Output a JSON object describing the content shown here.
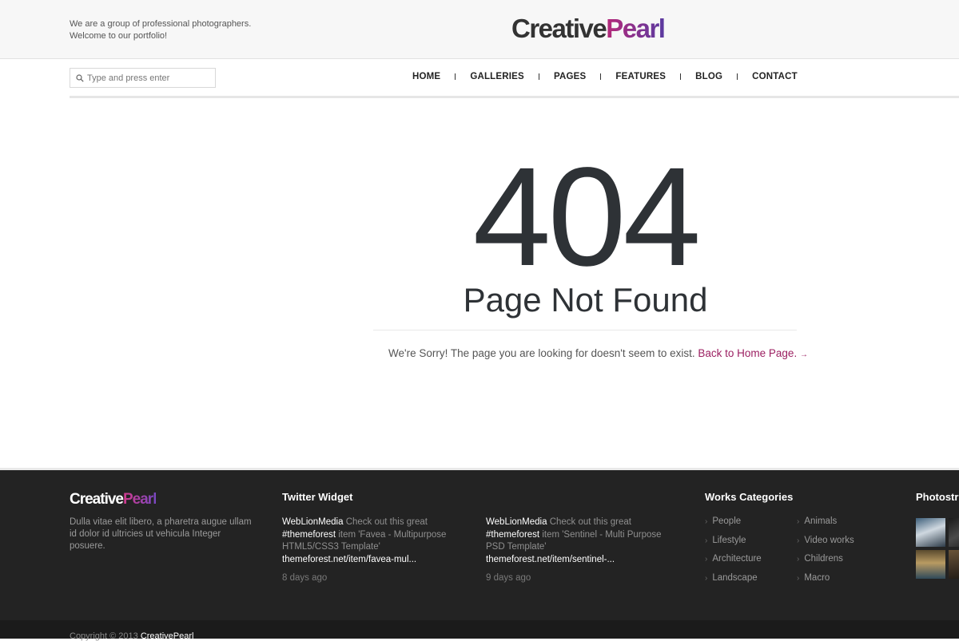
{
  "header": {
    "tagline_line1": "We are a group of professional photographers.",
    "tagline_line2": "Welcome to our portfolio!",
    "logo_part1": "Creative",
    "logo_part2": "Pearl"
  },
  "search": {
    "placeholder": "Type and press enter"
  },
  "nav": {
    "items": [
      "HOME",
      "GALLERIES",
      "PAGES",
      "FEATURES",
      "BLOG",
      "CONTACT"
    ]
  },
  "error": {
    "code": "404",
    "title": "Page Not Found",
    "message": "We're Sorry! The page you are looking for doesn't seem to exist.",
    "link_text": "Back to Home Page.",
    "link_arrow": "→"
  },
  "footer": {
    "logo_part1": "Creative",
    "logo_part2": "Pearl",
    "about": "Dulla vitae elit libero, a pharetra augue ullam id dolor id ultricies ut vehicula Integer posuere.",
    "twitter_title": "Twitter Widget",
    "tweets": [
      {
        "user": "WebLionMedia",
        "text_before": " Check out this great ",
        "hashtag": "#themeforest",
        "text_after": " item 'Favea - Multipurpose HTML5/CSS3 Template' ",
        "link": "themeforest.net/item/favea-mul...",
        "time": "8 days ago"
      },
      {
        "user": "WebLionMedia",
        "text_before": " Check out this great ",
        "hashtag": "#themeforest",
        "text_after": " item 'Sentinel - Multi Purpose PSD Template' ",
        "link": "themeforest.net/item/sentinel-...",
        "time": "9 days ago"
      }
    ],
    "categories_title": "Works Categories",
    "categories_col1": [
      "People",
      "Lifestyle",
      "Architecture",
      "Landscape"
    ],
    "categories_col2": [
      "Animals",
      "Video works",
      "Childrens",
      "Macro"
    ],
    "photostream_title": "Photostream",
    "copyright_prefix": "Copyright © 2013 ",
    "copyright_brand": "CreativePearl"
  },
  "colors": {
    "accent": "#9c2062",
    "footer_bg": "#232323",
    "text_dark": "#2e3236"
  }
}
